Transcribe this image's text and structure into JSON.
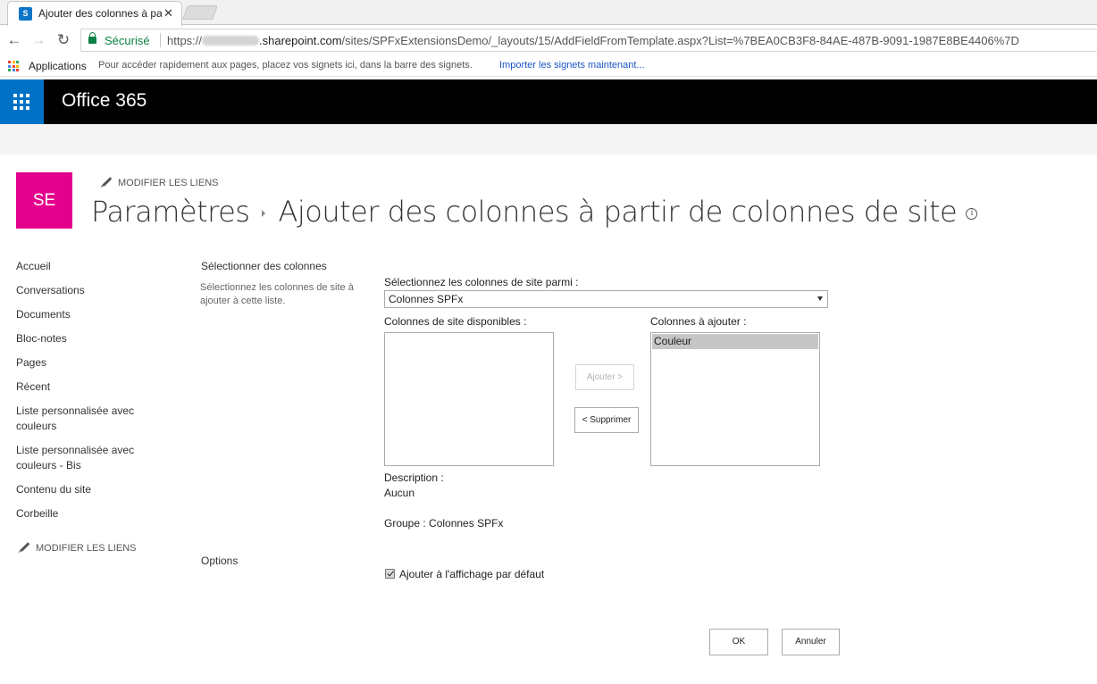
{
  "browser": {
    "tab_title": "Ajouter des colonnes à pa",
    "tab_favicon": "S",
    "secure_label": "Sécurisé",
    "url_scheme": "https://",
    "url_host": ".sharepoint.com",
    "url_path": "/sites/SPFxExtensionsDemo/_layouts/15/AddFieldFromTemplate.aspx?List=%7BEA0CB3F8-84AE-487B-9091-1987E8BE4406%7D",
    "bookmarks": {
      "apps": "Applications",
      "hint": "Pour accéder rapidement aux pages, placez vos signets ici, dans la barre des signets.",
      "import": "Importer les signets maintenant..."
    }
  },
  "suite": {
    "brand": "Office 365"
  },
  "site": {
    "logo": "SE",
    "edit_links": "MODIFIER LES LIENS"
  },
  "header": {
    "breadcrumb_root": "Paramètres",
    "page_title": "Ajouter des colonnes à partir de colonnes de site",
    "info_glyph": "i"
  },
  "leftnav": {
    "items": [
      "Accueil",
      "Conversations",
      "Documents",
      "Bloc-notes",
      "Pages",
      "Récent",
      "Liste personnalisée avec couleurs",
      "Liste personnalisée avec couleurs - Bis",
      "Contenu du site",
      "Corbeille"
    ],
    "edit_links": "MODIFIER LES LIENS"
  },
  "form": {
    "section_select_title": "Sélectionner des colonnes",
    "section_select_desc": "Sélectionnez les colonnes de site à ajouter à cette liste.",
    "select_from_label": "Sélectionnez les colonnes de site parmi :",
    "select_from_value": "Colonnes SPFx",
    "available_label": "Colonnes de site disponibles :",
    "to_add_label": "Colonnes à ajouter :",
    "to_add_items": [
      "Couleur"
    ],
    "add_button": "Ajouter >",
    "remove_button": "< Supprimer",
    "description_label": "Description :",
    "description_value": "Aucun",
    "group_text": "Groupe : Colonnes SPFx",
    "section_options_title": "Options",
    "default_view_label": "Ajouter à l'affichage par défaut",
    "default_view_checked": true,
    "ok_button": "OK",
    "cancel_button": "Annuler"
  },
  "colors": {
    "suite_bar": "#000000",
    "waffle": "#0072c6",
    "site_logo": "#e3008c",
    "secure": "#0b8043",
    "link": "#1a56c4"
  }
}
